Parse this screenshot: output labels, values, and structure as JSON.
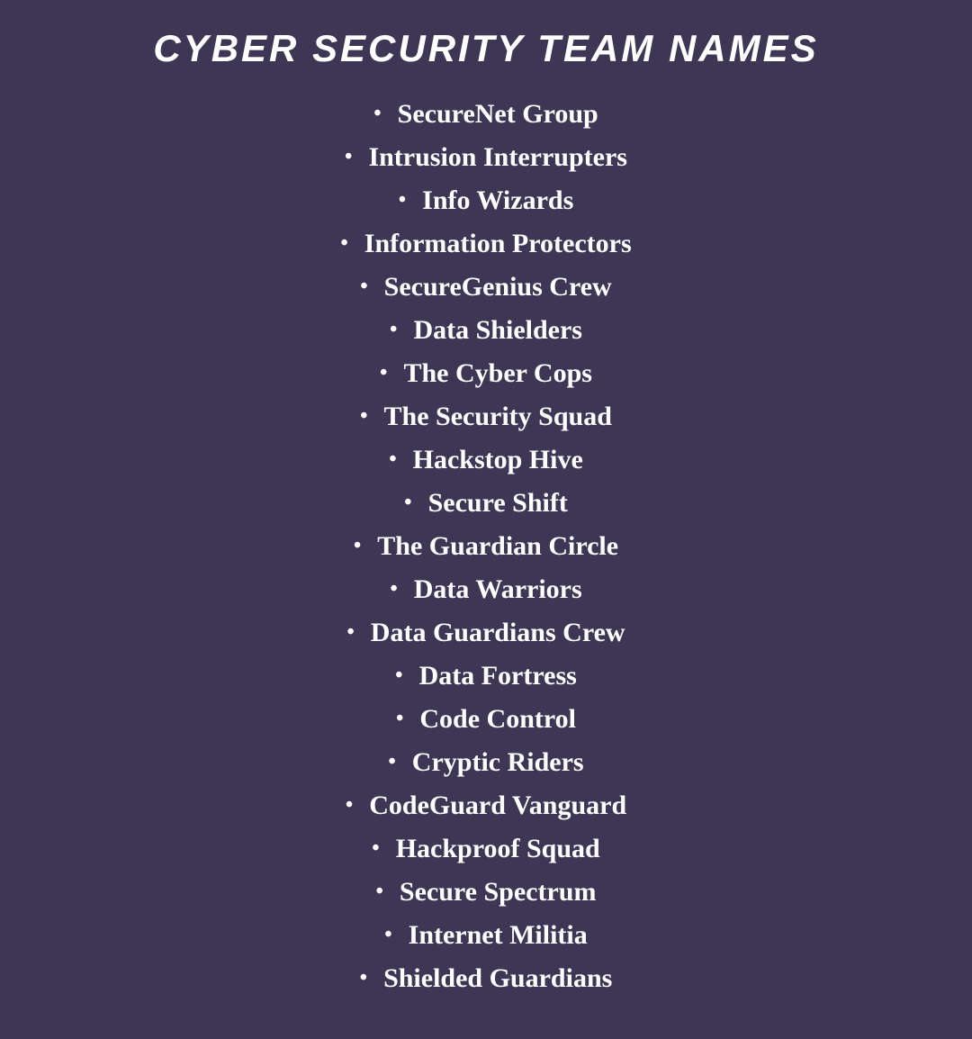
{
  "page": {
    "title": "CYBER SECURITY TEAM NAMES",
    "background_color": "#3d3654"
  },
  "list": {
    "items": [
      {
        "label": "SecureNet Group"
      },
      {
        "label": "Intrusion Interrupters"
      },
      {
        "label": "Info Wizards"
      },
      {
        "label": "Information Protectors"
      },
      {
        "label": "SecureGenius Crew"
      },
      {
        "label": "Data Shielders"
      },
      {
        "label": "The Cyber Cops"
      },
      {
        "label": "The Security Squad"
      },
      {
        "label": "Hackstop Hive"
      },
      {
        "label": "Secure Shift"
      },
      {
        "label": "The Guardian Circle"
      },
      {
        "label": "Data Warriors"
      },
      {
        "label": "Data Guardians Crew"
      },
      {
        "label": "Data Fortress"
      },
      {
        "label": "Code Control"
      },
      {
        "label": "Cryptic Riders"
      },
      {
        "label": "CodeGuard Vanguard"
      },
      {
        "label": "Hackproof Squad"
      },
      {
        "label": "Secure Spectrum"
      },
      {
        "label": "Internet Militia"
      },
      {
        "label": "Shielded Guardians"
      }
    ]
  }
}
